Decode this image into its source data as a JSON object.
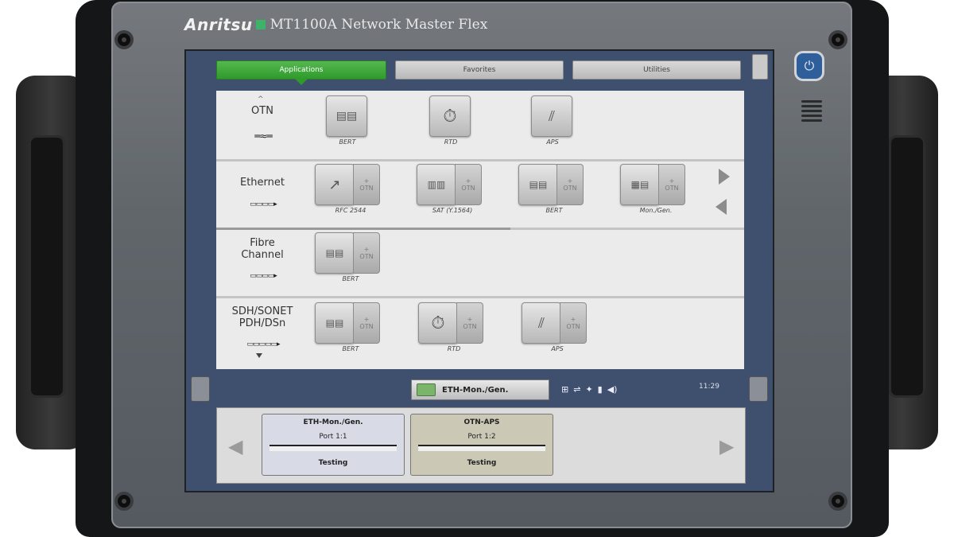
{
  "device": {
    "brand": "Anritsu",
    "model": "MT1100A Network Master Flex"
  },
  "tabs": [
    {
      "label": "Applications",
      "active": true
    },
    {
      "label": "Favorites",
      "active": false
    },
    {
      "label": "Utilities",
      "active": false
    }
  ],
  "categories": {
    "otn": {
      "label": "OTN",
      "apps": [
        "BERT",
        "RTD",
        "APS"
      ]
    },
    "ethernet": {
      "label": "Ethernet",
      "apps": [
        "RFC 2544",
        "SAT (Y.1564)",
        "BERT",
        "Mon./Gen."
      ]
    },
    "fibre": {
      "label_line1": "Fibre",
      "label_line2": "Channel",
      "apps": [
        "BERT"
      ]
    },
    "sdh": {
      "label_line1": "SDH/SONET",
      "label_line2": "PDH/DSn",
      "apps": [
        "BERT",
        "RTD",
        "APS"
      ]
    }
  },
  "otn_badge": {
    "plus": "+",
    "text": "OTN"
  },
  "status_bar": {
    "current_app": "ETH-Mon./Gen.",
    "time": "11:29"
  },
  "tests": [
    {
      "name": "ETH-Mon./Gen.",
      "port": "Port 1:1",
      "status": "Testing"
    },
    {
      "name": "OTN-APS",
      "port": "Port 1:2",
      "status": "Testing"
    }
  ],
  "colors": {
    "active_tab": "#2f9a2c",
    "screen_frame": "#3f4f6e",
    "card_selected": "#cbc9b6",
    "card_default": "#d8dbe6"
  },
  "icons": [
    "power-icon",
    "speaker-grille-icon",
    "network-icon",
    "usb-icon",
    "wifi-icon",
    "battery-icon",
    "volume-icon"
  ]
}
